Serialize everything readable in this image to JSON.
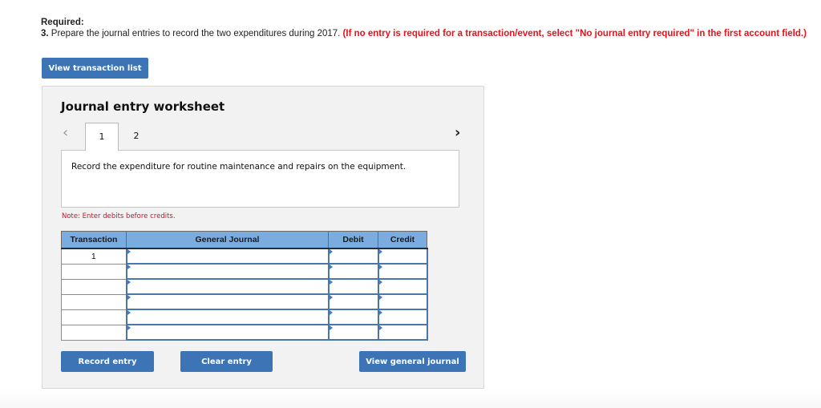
{
  "header": {
    "required_label": "Required:",
    "instruction_number": "3.",
    "instruction_text": " Prepare the journal entries to record the two expenditures during 2017. ",
    "instruction_warning": "(If no entry is required for a transaction/event, select \"No journal entry required\" in the first account field.)"
  },
  "toolbar": {
    "view_transaction_list_label": "View transaction list"
  },
  "worksheet": {
    "title": "Journal entry worksheet",
    "prev_icon": "chevron-left-icon",
    "next_icon": "chevron-right-icon",
    "tabs": [
      {
        "label": "1",
        "active": true
      },
      {
        "label": "2",
        "active": false
      }
    ],
    "description": "Record the expenditure for routine maintenance and repairs on the equipment.",
    "note": "Note: Enter debits before credits.",
    "table": {
      "columns": [
        "Transaction",
        "General Journal",
        "Debit",
        "Credit"
      ],
      "rows": [
        {
          "transaction": "1",
          "account": "",
          "debit": "",
          "credit": ""
        },
        {
          "transaction": "",
          "account": "",
          "debit": "",
          "credit": ""
        },
        {
          "transaction": "",
          "account": "",
          "debit": "",
          "credit": ""
        },
        {
          "transaction": "",
          "account": "",
          "debit": "",
          "credit": ""
        },
        {
          "transaction": "",
          "account": "",
          "debit": "",
          "credit": ""
        },
        {
          "transaction": "",
          "account": "",
          "debit": "",
          "credit": ""
        }
      ]
    },
    "buttons": {
      "record_entry": "Record entry",
      "clear_entry": "Clear entry",
      "view_general_journal": "View general journal"
    }
  },
  "colors": {
    "button_blue": "#3d74b6",
    "header_blue": "#7aace0",
    "warning_red": "#e8111b",
    "note_red": "#c0172c",
    "cell_border": "#4a76a8"
  }
}
